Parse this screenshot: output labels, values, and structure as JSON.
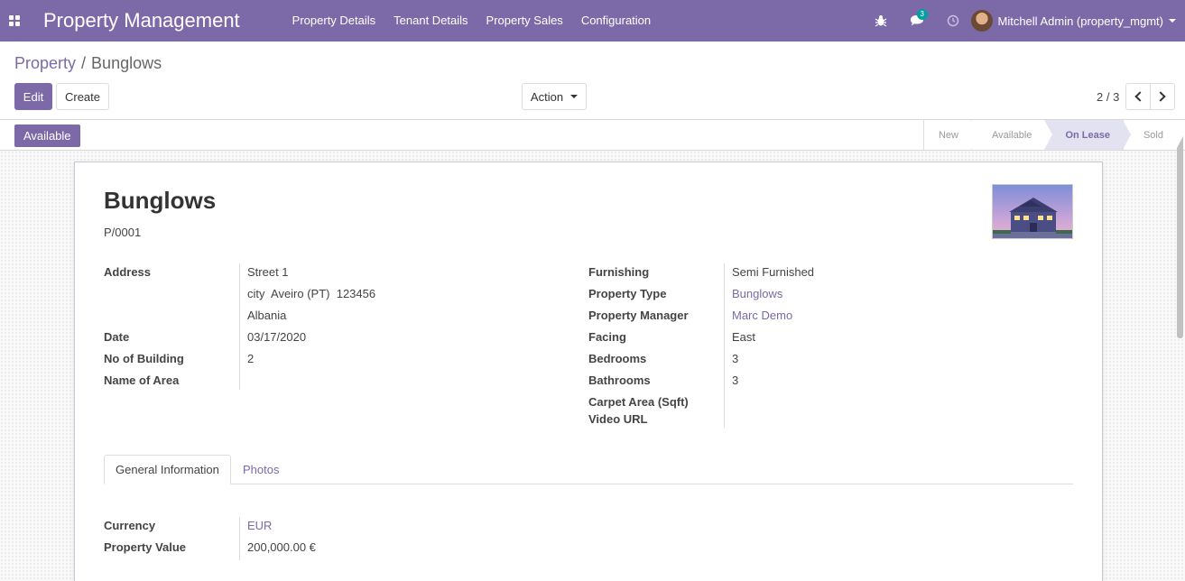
{
  "navbar": {
    "brand": "Property Management",
    "menu": [
      "Property Details",
      "Tenant Details",
      "Property Sales",
      "Configuration"
    ],
    "messages_count": "3",
    "user": "Mitchell Admin (property_mgmt)"
  },
  "breadcrumb": {
    "parent": "Property",
    "separator": "/",
    "current": "Bunglows"
  },
  "buttons": {
    "edit": "Edit",
    "create": "Create",
    "action": "Action"
  },
  "pager": {
    "text": "2 / 3"
  },
  "status": {
    "button": "Available",
    "stages": [
      "New",
      "Available",
      "On Lease",
      "Sold"
    ],
    "active_stage": "On Lease"
  },
  "record": {
    "title": "Bunglows",
    "reference": "P/0001",
    "left_fields": {
      "address_label": "Address",
      "street": "Street 1",
      "city_line": "city  Aveiro (PT)  123456",
      "country": "Albania",
      "date_label": "Date",
      "date": "03/17/2020",
      "building_label": "No of Building",
      "building": "2",
      "area_label": "Name of Area",
      "area": ""
    },
    "right_fields": {
      "furnishing_label": "Furnishing",
      "furnishing": "Semi Furnished",
      "type_label": "Property Type",
      "type": "Bunglows",
      "manager_label": "Property Manager",
      "manager": "Marc Demo",
      "facing_label": "Facing",
      "facing": "East",
      "bedrooms_label": "Bedrooms",
      "bedrooms": "3",
      "bathrooms_label": "Bathrooms",
      "bathrooms": "3",
      "carpet_label": "Carpet Area (Sqft)",
      "video_label": "Video URL"
    },
    "tabs": [
      "General Information",
      "Photos"
    ],
    "general": {
      "currency_label": "Currency",
      "currency": "EUR",
      "value_label": "Property Value",
      "value": "200,000.00 €"
    }
  },
  "colors": {
    "primary": "#7c6aa8",
    "accent": "#00a09d"
  }
}
